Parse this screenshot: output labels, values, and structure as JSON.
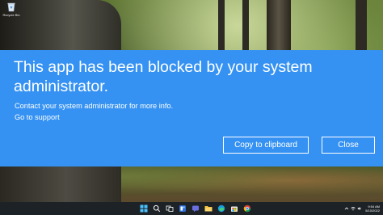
{
  "desktop": {
    "recycle_bin_label": "Recycle Bin"
  },
  "dialog": {
    "title": "This app has been blocked by your system administrator.",
    "message": "Contact your system administrator for more info.",
    "support_link": "Go to support",
    "copy_button": "Copy to clipboard",
    "close_button": "Close",
    "background_color": "#3592f3"
  },
  "taskbar": {
    "pinned_icons": [
      "windows-start-icon",
      "search-icon",
      "task-view-icon",
      "widgets-icon",
      "chat-icon",
      "file-explorer-icon",
      "edge-icon",
      "store-icon",
      "chrome-icon"
    ],
    "clock": {
      "time": "9:54 AM",
      "date": "5/10/2022"
    }
  }
}
